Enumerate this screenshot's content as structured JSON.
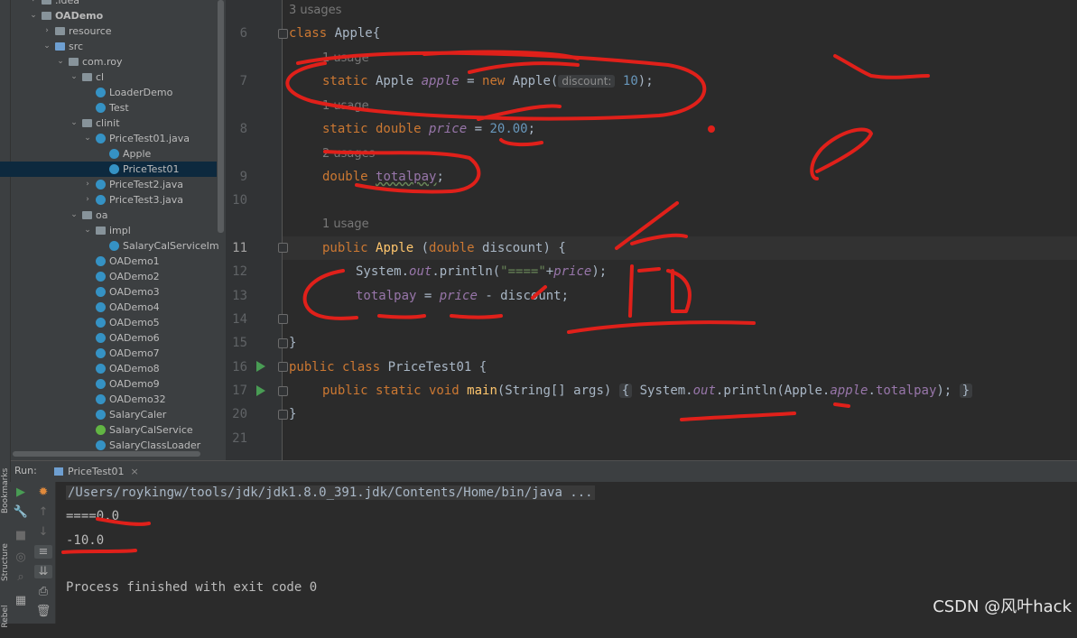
{
  "tree": [
    {
      "label": ".idea",
      "depth": 2,
      "type": "folder",
      "arrow": "›"
    },
    {
      "label": "OADemo",
      "depth": 2,
      "type": "folder",
      "arrow": "⌄",
      "bold": true
    },
    {
      "label": "resource",
      "depth": 3,
      "type": "folder",
      "arrow": "›"
    },
    {
      "label": "src",
      "depth": 3,
      "type": "folder-blue",
      "arrow": "⌄"
    },
    {
      "label": "com.roy",
      "depth": 4,
      "type": "pkg",
      "arrow": "⌄"
    },
    {
      "label": "cl",
      "depth": 5,
      "type": "pkg",
      "arrow": "⌄"
    },
    {
      "label": "LoaderDemo",
      "depth": 6,
      "type": "class"
    },
    {
      "label": "Test",
      "depth": 6,
      "type": "class"
    },
    {
      "label": "clinit",
      "depth": 5,
      "type": "pkg",
      "arrow": "⌄"
    },
    {
      "label": "PriceTest01.java",
      "depth": 6,
      "type": "class",
      "arrow": "⌄"
    },
    {
      "label": "Apple",
      "depth": 7,
      "type": "class"
    },
    {
      "label": "PriceTest01",
      "depth": 7,
      "type": "class",
      "selected": true
    },
    {
      "label": "PriceTest2.java",
      "depth": 6,
      "type": "class",
      "arrow": "›"
    },
    {
      "label": "PriceTest3.java",
      "depth": 6,
      "type": "class",
      "arrow": "›"
    },
    {
      "label": "oa",
      "depth": 5,
      "type": "pkg",
      "arrow": "⌄"
    },
    {
      "label": "impl",
      "depth": 6,
      "type": "pkg",
      "arrow": "⌄"
    },
    {
      "label": "SalaryCalServiceIm",
      "depth": 7,
      "type": "class"
    },
    {
      "label": "OADemo1",
      "depth": 6,
      "type": "class"
    },
    {
      "label": "OADemo2",
      "depth": 6,
      "type": "class"
    },
    {
      "label": "OADemo3",
      "depth": 6,
      "type": "class"
    },
    {
      "label": "OADemo4",
      "depth": 6,
      "type": "class"
    },
    {
      "label": "OADemo5",
      "depth": 6,
      "type": "class"
    },
    {
      "label": "OADemo6",
      "depth": 6,
      "type": "class"
    },
    {
      "label": "OADemo7",
      "depth": 6,
      "type": "class"
    },
    {
      "label": "OADemo8",
      "depth": 6,
      "type": "class"
    },
    {
      "label": "OADemo9",
      "depth": 6,
      "type": "class"
    },
    {
      "label": "OADemo32",
      "depth": 6,
      "type": "class"
    },
    {
      "label": "SalaryCaler",
      "depth": 6,
      "type": "class"
    },
    {
      "label": "SalaryCalService",
      "depth": 6,
      "type": "interface"
    },
    {
      "label": "SalaryClassLoader",
      "depth": 6,
      "type": "class"
    }
  ],
  "editor": {
    "usages": {
      "u3": "3 usages",
      "u1a": "1 usage",
      "u1b": "1 usage",
      "u2": "2 usages",
      "u1c": "1 usage"
    },
    "line_numbers": [
      "6",
      "7",
      "8",
      "9",
      "10",
      "11",
      "12",
      "13",
      "14",
      "15",
      "16",
      "17",
      "20",
      "21"
    ],
    "inlay_discount": "discount:",
    "code": {
      "l6_kw": "class",
      "l6_rest": " Apple{",
      "l7_kw": "static",
      "l7_a": " Apple ",
      "l7_fld": "apple",
      "l7_b": " = ",
      "l7_new": "new",
      "l7_c": " Apple(",
      "l7_num": "10",
      "l7_d": ");",
      "l8_kw": "static double",
      "l8_fld": "price",
      "l8_b": " = ",
      "l8_num": "20.00",
      "l8_c": ";",
      "l9_kw": "double",
      "l9_fld": "totalpay",
      "l9_c": ";",
      "l11_kw": "public",
      "l11_fn": "Apple",
      "l11_b": " (",
      "l11_kw2": "double",
      "l11_c": " discount) {",
      "l12_a": "System.",
      "l12_out": "out",
      "l12_b": ".println(",
      "l12_str": "\"====\"",
      "l12_c": "+",
      "l12_fld": "price",
      "l12_d": ");",
      "l13_fld": "totalpay",
      "l13_b": " = ",
      "l13_fld2": "price",
      "l13_c": " - discount;",
      "l15": "}",
      "l16_kw": "public class",
      "l16_rest": " PriceTest01 {",
      "l17_kw": "public static void",
      "l17_fn": "main",
      "l17_b": "(String[] args) ",
      "l17_fold_open": "{",
      "l17_c": " System.",
      "l17_out": "out",
      "l17_d": ".println(Apple.",
      "l17_fld": "apple",
      "l17_e": ".",
      "l17_fld2": "totalpay",
      "l17_f": ");",
      "l17_fold_close": "}",
      "l20": "}"
    }
  },
  "run": {
    "label": "Run:",
    "tab": "PriceTest01",
    "tab_close": "×",
    "output": {
      "cmd": "/Users/roykingw/tools/jdk/jdk1.8.0_391.jdk/Contents/Home/bin/java ...",
      "line1": "====0.0",
      "line2": "-10.0",
      "line3": "Process finished with exit code 0"
    },
    "side_labels": {
      "bookmarks": "Bookmarks",
      "structure": "Structure",
      "rebel": "Rebel"
    }
  },
  "watermark": "CSDN @风叶hack",
  "colors": {
    "annotation": "#e0201a",
    "keyword": "#cc7832",
    "field": "#9876aa",
    "number": "#6897bb",
    "string": "#6a8759",
    "method": "#ffc66d"
  }
}
